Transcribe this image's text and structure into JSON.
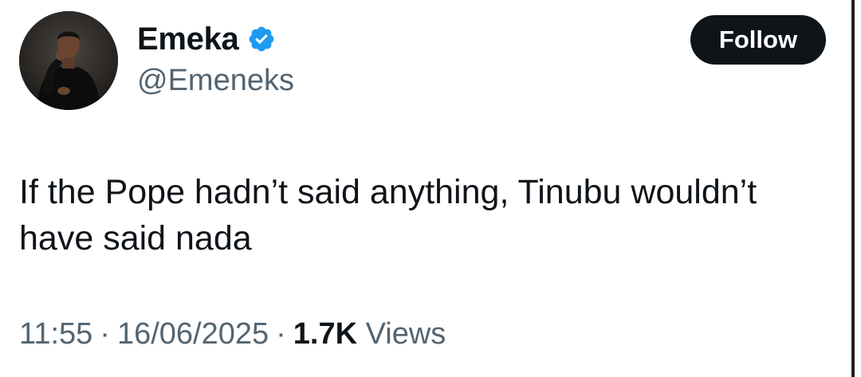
{
  "author": {
    "display_name": "Emeka",
    "handle": "@Emeneks",
    "verified": true
  },
  "follow_button": {
    "label": "Follow"
  },
  "tweet": {
    "text": "If the Pope hadn’t said anything, Tinubu wouldn’t\nhave said nada",
    "time": "11:55",
    "separator": "·",
    "date": "16/06/2025",
    "views_count": "1.7K",
    "views_label": "Views"
  },
  "colors": {
    "text_primary": "#0f1419",
    "text_secondary": "#536471",
    "verified_blue": "#1d9bf0",
    "button_bg": "#0f1419"
  },
  "icons": {
    "verified": "verified-badge-icon"
  }
}
